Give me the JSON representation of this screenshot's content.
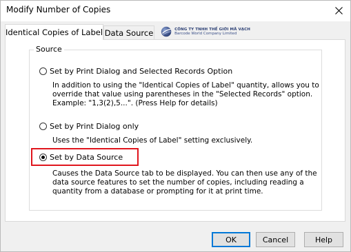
{
  "window": {
    "title": "Modify Number of Copies"
  },
  "tabs": [
    {
      "label": "Identical Copies of Label",
      "active": true
    },
    {
      "label": "Data Source",
      "active": false
    }
  ],
  "logo": {
    "line1": "CÔNG TY TNHH THẾ GIỚI MÃ VẠCH",
    "line2": "Barcode World Company Limited"
  },
  "group": {
    "label": "Source"
  },
  "options": [
    {
      "label": "Set by Print Dialog and Selected Records Option",
      "selected": false,
      "description": [
        "In addition to using the \"Identical Copies of Label\" quantity, allows you to",
        "override that value using parentheses in the \"Selected Records\" option.",
        "Example: \"1,3(2),5...\".  (Press Help for details)"
      ]
    },
    {
      "label": "Set by Print Dialog only",
      "selected": false,
      "description": [
        "Uses the \"Identical Copies of Label\" setting exclusively."
      ]
    },
    {
      "label": "Set by Data Source",
      "selected": true,
      "description": [
        "Causes the Data Source tab to be displayed.  You can then use any of the",
        "data source features to set the number of copies, including reading a",
        "quantity from a database or prompting for it at print time."
      ]
    }
  ],
  "buttons": {
    "ok": "OK",
    "cancel": "Cancel",
    "help": "Help"
  },
  "colors": {
    "highlight": "#e0141c",
    "default_button_border": "#0078d7",
    "logo_text": "#2b3f74"
  }
}
